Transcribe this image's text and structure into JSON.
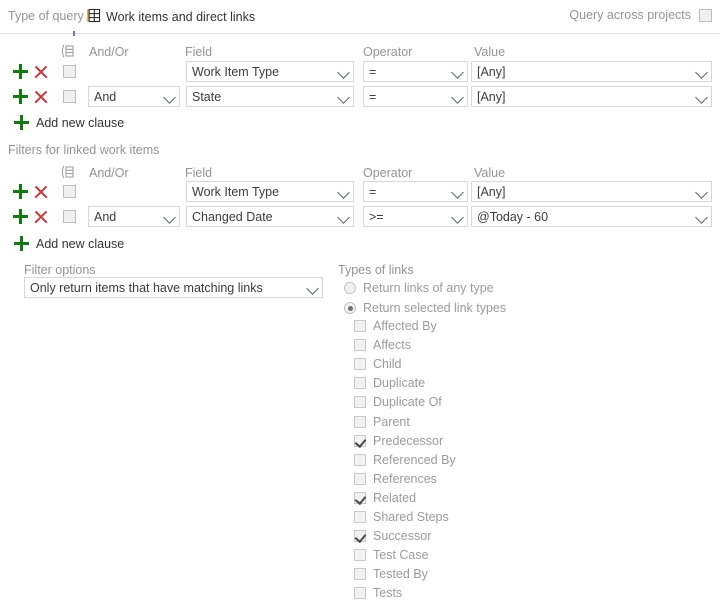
{
  "topbar": {
    "type_of_query_label": "Type of query",
    "query_type_value": "Work items and direct links",
    "query_type_icon": "grid-table-icon",
    "across_projects_label": "Query across projects",
    "across_projects_checked": false
  },
  "columns": {
    "andor": "And/Or",
    "field": "Field",
    "operator": "Operator",
    "value": "Value",
    "group_icon": "group-clauses-icon"
  },
  "top_section": {
    "title": "",
    "rows": [
      {
        "andor": "",
        "field": "Work Item Type",
        "operator": "=",
        "value": "[Any]",
        "checked": false
      },
      {
        "andor": "And",
        "field": "State",
        "operator": "=",
        "value": "[Any]",
        "checked": false
      }
    ],
    "add_clause_label": "Add new clause"
  },
  "linked_section": {
    "title": "Filters for linked work items",
    "rows": [
      {
        "andor": "",
        "field": "Work Item Type",
        "operator": "=",
        "value": "[Any]",
        "checked": false
      },
      {
        "andor": "And",
        "field": "Changed Date",
        "operator": ">=",
        "value": "@Today - 60",
        "checked": false
      }
    ],
    "add_clause_label": "Add new clause"
  },
  "filter_options": {
    "label": "Filter options",
    "selected": "Only return items that have matching links"
  },
  "types_of_links": {
    "title": "Types of links",
    "radios": [
      {
        "label": "Return links of any type",
        "selected": false
      },
      {
        "label": "Return selected link types",
        "selected": true
      }
    ],
    "link_types": [
      {
        "label": "Affected By",
        "checked": false
      },
      {
        "label": "Affects",
        "checked": false
      },
      {
        "label": "Child",
        "checked": false
      },
      {
        "label": "Duplicate",
        "checked": false
      },
      {
        "label": "Duplicate Of",
        "checked": false
      },
      {
        "label": "Parent",
        "checked": false
      },
      {
        "label": "Predecessor",
        "checked": true
      },
      {
        "label": "Referenced By",
        "checked": false
      },
      {
        "label": "References",
        "checked": false
      },
      {
        "label": "Related",
        "checked": true
      },
      {
        "label": "Shared Steps",
        "checked": false
      },
      {
        "label": "Successor",
        "checked": true
      },
      {
        "label": "Test Case",
        "checked": false
      },
      {
        "label": "Tested By",
        "checked": false
      },
      {
        "label": "Tests",
        "checked": false
      }
    ]
  },
  "colors": {
    "add": "#107c10",
    "remove": "#d13438",
    "label_gray": "#949494",
    "text": "#333333"
  }
}
